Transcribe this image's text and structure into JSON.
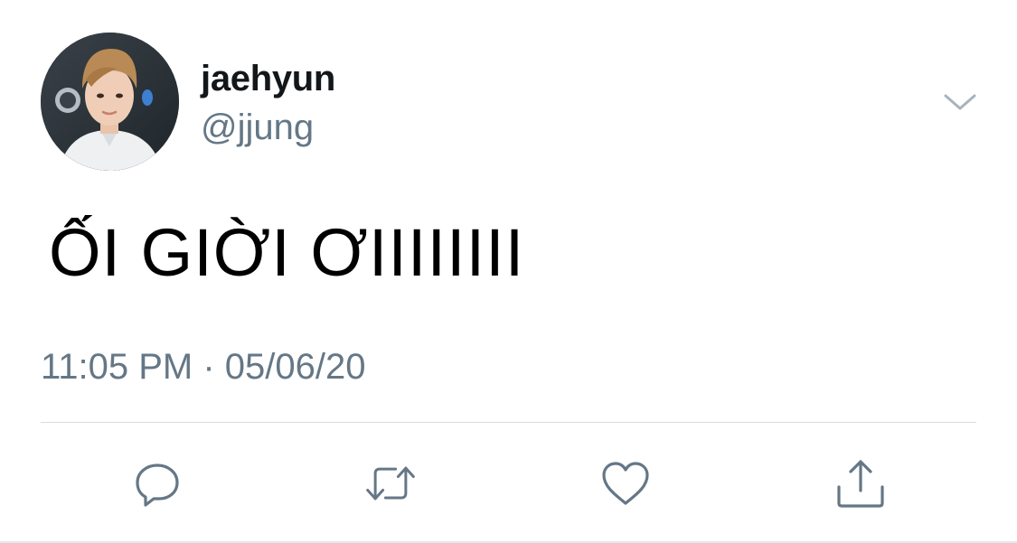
{
  "user": {
    "display_name": "jaehyun",
    "handle": "@jjung"
  },
  "tweet": {
    "text": "ỐI GIỜI ƠIIIIIIII",
    "timestamp": "11:05 PM · 05/06/20"
  },
  "icons": {
    "menu": "chevron-down-icon",
    "reply": "reply-icon",
    "retweet": "retweet-icon",
    "like": "heart-icon",
    "share": "share-icon"
  },
  "colors": {
    "text_primary": "#14171a",
    "text_secondary": "#657786",
    "icon": "#657786",
    "divider": "#d7dde2"
  }
}
